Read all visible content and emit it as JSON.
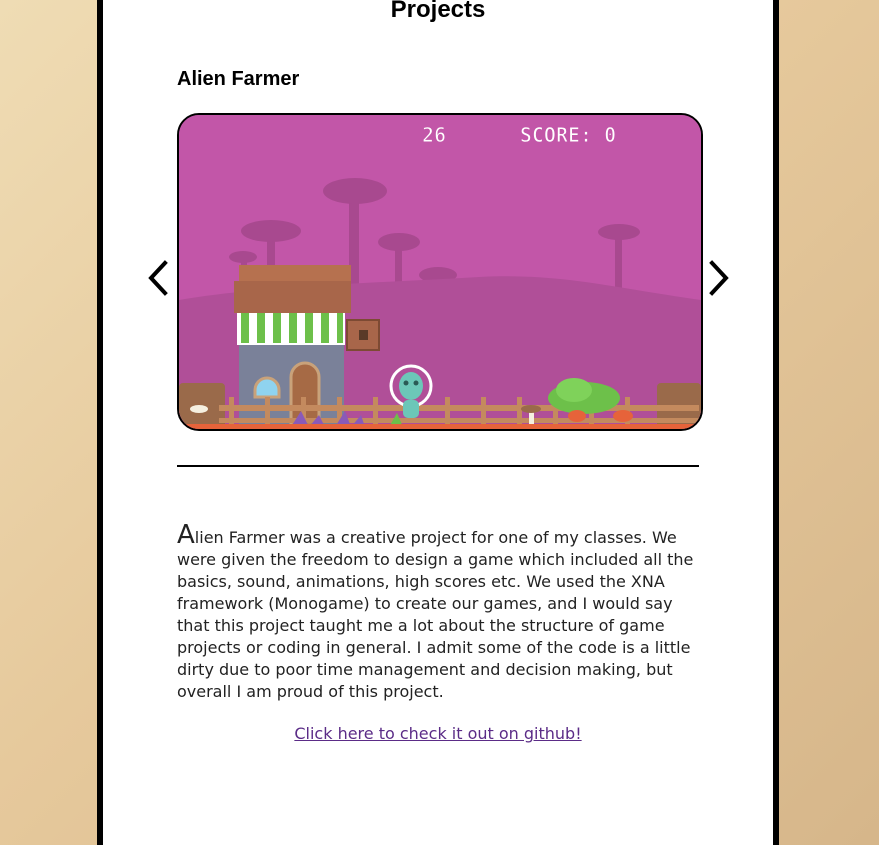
{
  "page": {
    "title": "Projects"
  },
  "project": {
    "title": "Alien Farmer",
    "screenshot": {
      "hud_timer": "26",
      "hud_score": "SCORE: 0",
      "colors": {
        "sky": "#c256a8",
        "ground": "#b04f98",
        "silhouette": "#a8498f"
      }
    },
    "carousel": {
      "prev_icon": "chevron-left-icon",
      "next_icon": "chevron-right-icon"
    },
    "description_dropcap": "A",
    "description_rest": "lien Farmer was a creative project for one of my classes. We were given the freedom to design a game which included all the basics, sound, animations, high scores etc. We used the XNA framework (Monogame) to create our games, and I would say that this project taught me a lot about the structure of game projects or coding in general. I admit some of the code is a little dirty due to poor time management and decision making, but overall I am proud of this project.",
    "github_link": "Click here to check it out on github!"
  }
}
